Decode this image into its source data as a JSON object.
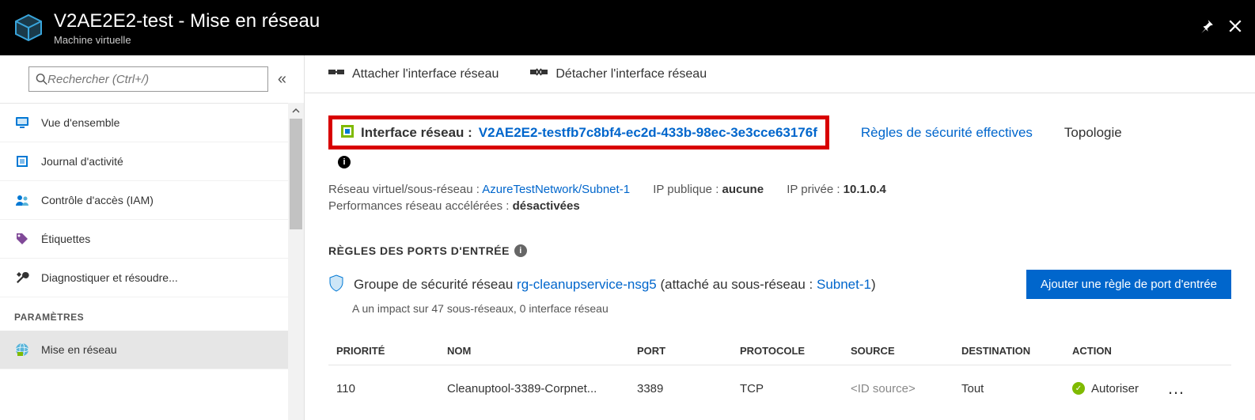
{
  "header": {
    "title": "V2AE2E2-test - Mise en réseau",
    "subtitle": "Machine virtuelle"
  },
  "search": {
    "placeholder": "Rechercher (Ctrl+/)"
  },
  "nav": {
    "items": [
      {
        "label": "Vue d'ensemble",
        "icon": "monitor"
      },
      {
        "label": "Journal d'activité",
        "icon": "log"
      },
      {
        "label": "Contrôle d'accès (IAM)",
        "icon": "iam"
      },
      {
        "label": "Étiquettes",
        "icon": "tag"
      },
      {
        "label": "Diagnostiquer et résoudre...",
        "icon": "wrench"
      }
    ],
    "section": "PARAMÈTRES",
    "selected": {
      "label": "Mise en réseau",
      "icon": "globe"
    }
  },
  "toolbar": {
    "attach": "Attacher l'interface réseau",
    "detach": "Détacher l'interface réseau"
  },
  "nic": {
    "label": "Interface réseau :",
    "name": "V2AE2E2-testfb7c8bf4-ec2d-433b-98ec-3e3cce63176f",
    "eff_rules": "Règles de sécurité effectives",
    "topology": "Topologie"
  },
  "meta": {
    "vnet_label": "Réseau virtuel/sous-réseau :",
    "vnet_value": "AzureTestNetwork/Subnet-1",
    "pubip_label": "IP publique :",
    "pubip_value": "aucune",
    "privip_label": "IP privée :",
    "privip_value": "10.1.0.4",
    "accel_label": "Performances réseau accélérées :",
    "accel_value": "désactivées"
  },
  "rules": {
    "title": "RÈGLES DES PORTS D'ENTRÉE",
    "nsg_prefix": "Groupe de sécurité réseau",
    "nsg_name": "rg-cleanupservice-nsg5",
    "nsg_suffix_1": "(attaché au sous-réseau :",
    "nsg_subnet": "Subnet-1",
    "nsg_suffix_2": ")",
    "impact": "A un impact sur 47 sous-réseaux, 0 interface réseau",
    "add_btn": "Ajouter une règle de port d'entrée",
    "columns": {
      "priority": "PRIORITÉ",
      "name": "NOM",
      "port": "PORT",
      "protocol": "PROTOCOLE",
      "source": "SOURCE",
      "destination": "DESTINATION",
      "action": "ACTION"
    },
    "rows": [
      {
        "priority": "110",
        "name": "Cleanuptool-3389-Corpnet...",
        "port": "3389",
        "protocol": "TCP",
        "source": "<ID source>",
        "destination": "Tout",
        "action": "Autoriser"
      }
    ]
  }
}
